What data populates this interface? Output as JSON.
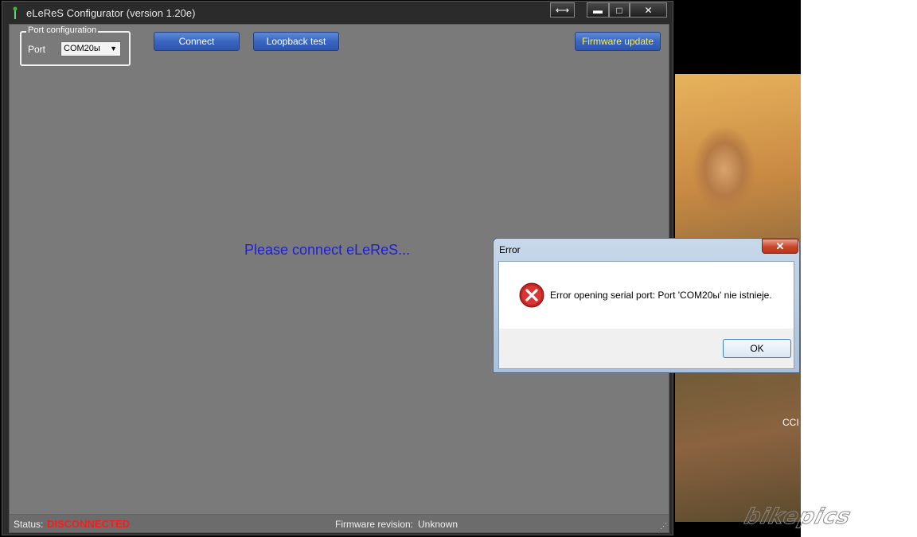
{
  "window": {
    "title": "eLeReS Configurator (version  1.20e)",
    "buttons": {
      "resize": "⟷",
      "minimize": "▬",
      "maximize": "□",
      "close": "✕"
    }
  },
  "port_config": {
    "legend": "Port configuration",
    "port_label": "Port",
    "port_value": "COM20ы"
  },
  "toolbar": {
    "connect": "Connect",
    "loopback": "Loopback test",
    "firmware_update": "Firmware update"
  },
  "main": {
    "message": "Please connect eLeReS..."
  },
  "statusbar": {
    "status_label": "Status:",
    "status_value": "DISCONNECTED",
    "fw_label": "Firmware revision:",
    "fw_value": "Unknown"
  },
  "dialog": {
    "title": "Error",
    "close": "✕",
    "message": "Error opening serial port: Port 'COM20ы' nie istnieje.",
    "ok": "OK"
  },
  "desktop": {
    "wallpaper_text": "CCI",
    "watermark": "bikepics"
  },
  "colors": {
    "status_error": "#ff1a1a",
    "message_blue": "#1f1fd8",
    "button_blue": "#3a66c2",
    "button_yellow_text": "#f7f060"
  }
}
